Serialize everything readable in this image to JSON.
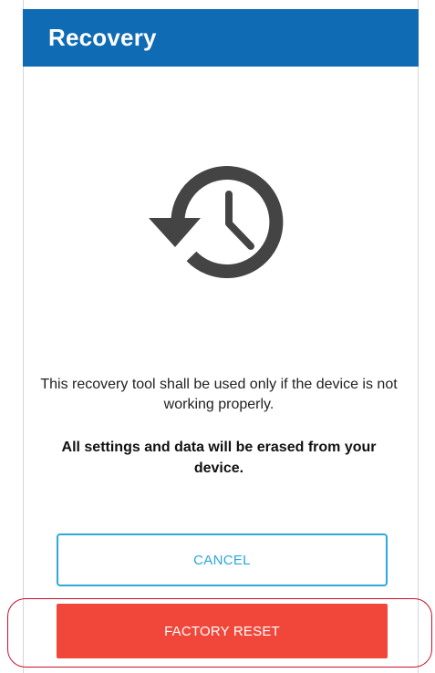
{
  "header": {
    "title": "Recovery"
  },
  "content": {
    "icon": "restore-history-icon",
    "description": "This recovery tool shall be used only if the device is not working properly.",
    "warning": "All settings and data will be erased from your device."
  },
  "actions": {
    "cancel_label": "CANCEL",
    "factory_reset_label": "FACTORY RESET"
  },
  "colors": {
    "header": "#0f6bb3",
    "cancel_border": "#2ea8e0",
    "cancel_text": "#2aa6de",
    "reset_button": "#f1473a",
    "icon": "#444444",
    "highlight": "#c8102e"
  }
}
